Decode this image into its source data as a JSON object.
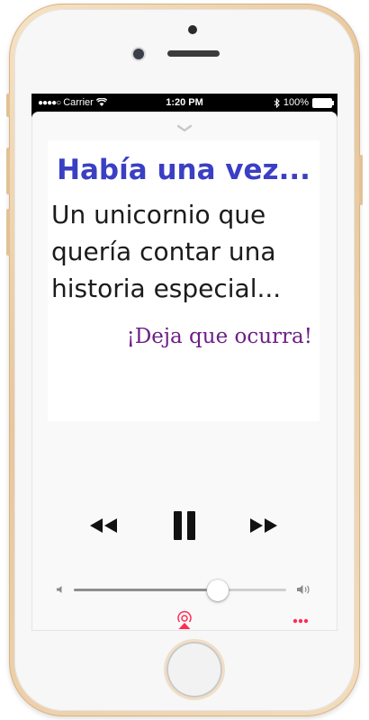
{
  "status_bar": {
    "signal": "●●●●○",
    "carrier": "Carrier",
    "time": "1:20 PM",
    "battery": "100%"
  },
  "artwork": {
    "title": "Había una vez...",
    "body": "Un unicornio que quería contar una historia especial...",
    "cta": "¡Deja que ocurra!"
  },
  "player": {
    "state": "playing",
    "volume_level": 0.68
  },
  "colors": {
    "title": "#3a3fc4",
    "cta": "#6d1f86",
    "accent": "#ff2d55"
  },
  "icons": {
    "wifi": "wifi-icon",
    "bluetooth": "bluetooth-icon",
    "rewind": "rewind-icon",
    "pause": "pause-icon",
    "forward": "fast-forward-icon",
    "volume_low": "volume-low-icon",
    "volume_high": "volume-high-icon",
    "airplay": "airplay-icon",
    "more": "more-icon"
  }
}
